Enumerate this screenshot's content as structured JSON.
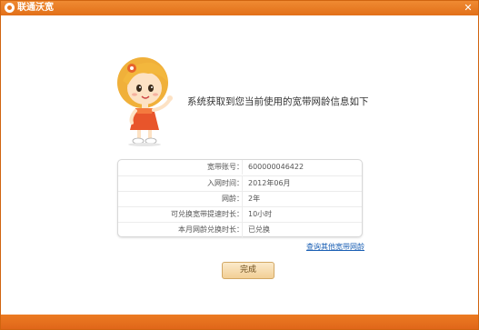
{
  "window": {
    "title": "联通沃宽",
    "close_glyph": "✕"
  },
  "headline": "系统获取到您当前使用的宽带网龄信息如下",
  "info": [
    {
      "label": "宽带账号：",
      "value": "600000046422"
    },
    {
      "label": "入网时间：",
      "value": "2012年06月"
    },
    {
      "label": "网龄：",
      "value": "2年"
    },
    {
      "label": "可兑换宽带提速时长：",
      "value": "10小时"
    },
    {
      "label": "本月网龄兑换时长：",
      "value": "已兑换"
    }
  ],
  "link_text": "查询其他宽带网龄",
  "finish_label": "完成",
  "colors": {
    "titlebar": "#e87520",
    "link": "#1a5fb4",
    "button": "#f4d7a6"
  },
  "icons": {
    "app": "unicom-logo-icon",
    "close": "close-icon",
    "mascot": "cartoon-girl-mascot"
  }
}
